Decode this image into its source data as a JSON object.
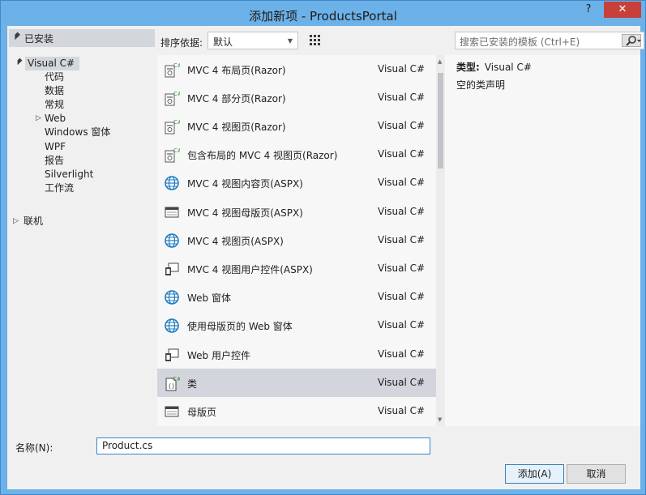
{
  "window": {
    "title": "添加新项 - ProductsPortal",
    "help": "?",
    "close": "✕"
  },
  "tree": {
    "header": "已安装",
    "root": "Visual C#",
    "children": [
      "代码",
      "数据",
      "常规",
      "Web",
      "Windows 窗体",
      "WPF",
      "报告",
      "Silverlight",
      "工作流"
    ],
    "online": "联机"
  },
  "sort": {
    "label": "排序依据:",
    "value": "默认"
  },
  "search": {
    "placeholder": "搜索已安装的模板 (Ctrl+E)"
  },
  "templates": [
    {
      "name": "MVC 4 布局页(Razor)",
      "lang": "Visual C#",
      "icon": "razor-page-icon"
    },
    {
      "name": "MVC 4 部分页(Razor)",
      "lang": "Visual C#",
      "icon": "razor-page-icon"
    },
    {
      "name": "MVC 4 视图页(Razor)",
      "lang": "Visual C#",
      "icon": "razor-page-icon"
    },
    {
      "name": "包含布局的 MVC 4 视图页(Razor)",
      "lang": "Visual C#",
      "icon": "razor-page-icon"
    },
    {
      "name": "MVC 4 视图内容页(ASPX)",
      "lang": "Visual C#",
      "icon": "globe-icon"
    },
    {
      "name": "MVC 4 视图母版页(ASPX)",
      "lang": "Visual C#",
      "icon": "master-page-icon"
    },
    {
      "name": "MVC 4 视图页(ASPX)",
      "lang": "Visual C#",
      "icon": "globe-icon"
    },
    {
      "name": "MVC 4 视图用户控件(ASPX)",
      "lang": "Visual C#",
      "icon": "user-control-icon"
    },
    {
      "name": "Web 窗体",
      "lang": "Visual C#",
      "icon": "globe-icon"
    },
    {
      "name": "使用母版页的 Web 窗体",
      "lang": "Visual C#",
      "icon": "globe-icon"
    },
    {
      "name": "Web 用户控件",
      "lang": "Visual C#",
      "icon": "user-control-icon"
    },
    {
      "name": "类",
      "lang": "Visual C#",
      "icon": "csharp-class-icon"
    },
    {
      "name": "母版页",
      "lang": "Visual C#",
      "icon": "master-page-icon"
    }
  ],
  "selected_index": 11,
  "details": {
    "type_label": "类型:",
    "type_value": "Visual C#",
    "description": "空的类声明"
  },
  "name_field": {
    "label": "名称(N):",
    "value": "Product.cs"
  },
  "buttons": {
    "add": "添加(A)",
    "cancel": "取消"
  },
  "colors": {
    "title_bg": "#6cb1e8",
    "selection": "#d2d5db",
    "close_button": "#c7403a",
    "accent": "#3a86d0"
  }
}
